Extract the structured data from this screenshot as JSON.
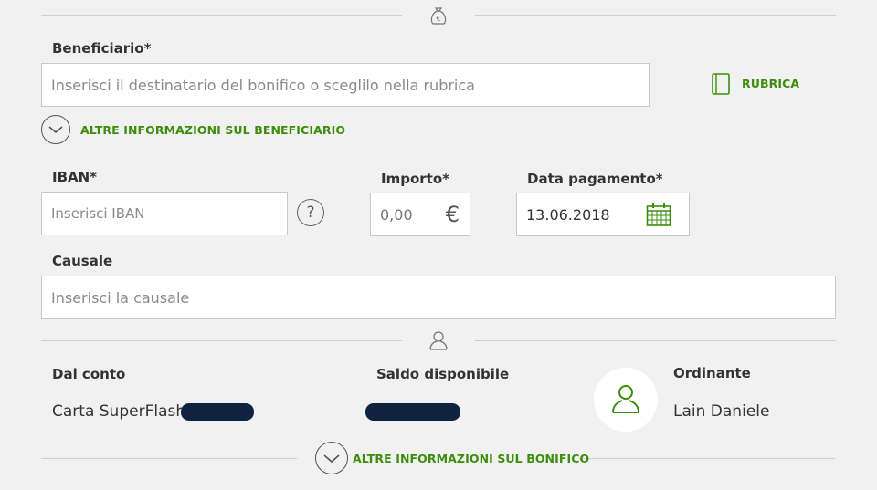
{
  "top_divider": {
    "icon": "money-bag-euro-icon"
  },
  "beneficiario": {
    "label": "Beneficiario*",
    "placeholder": "Inserisci il destinatario del bonifico o sceglilo nella rubrica",
    "rubrica_label": "RUBRICA",
    "more_info_label": "ALTRE INFORMAZIONI SUL BENEFICIARIO"
  },
  "iban": {
    "label": "IBAN*",
    "placeholder": "Inserisci IBAN",
    "help_icon": "?"
  },
  "importo": {
    "label": "Importo*",
    "placeholder": "0,00",
    "currency": "€"
  },
  "data_pagamento": {
    "label": "Data pagamento*",
    "value": "13.06.2018"
  },
  "causale": {
    "label": "Causale",
    "placeholder": "Inserisci la causale"
  },
  "mid_divider": {
    "icon": "user-icon"
  },
  "conto": {
    "label": "Dal conto",
    "value": "Carta SuperFlash -"
  },
  "saldo": {
    "label": "Saldo disponibile"
  },
  "ordinante": {
    "label": "Ordinante",
    "value": "Lain Daniele"
  },
  "bonifico": {
    "more_info_label": "ALTRE INFORMAZIONI SUL BONIFICO"
  },
  "colors": {
    "accent": "#3c8d0b",
    "background": "#f1f1f1",
    "redacted": "#0f2340"
  }
}
